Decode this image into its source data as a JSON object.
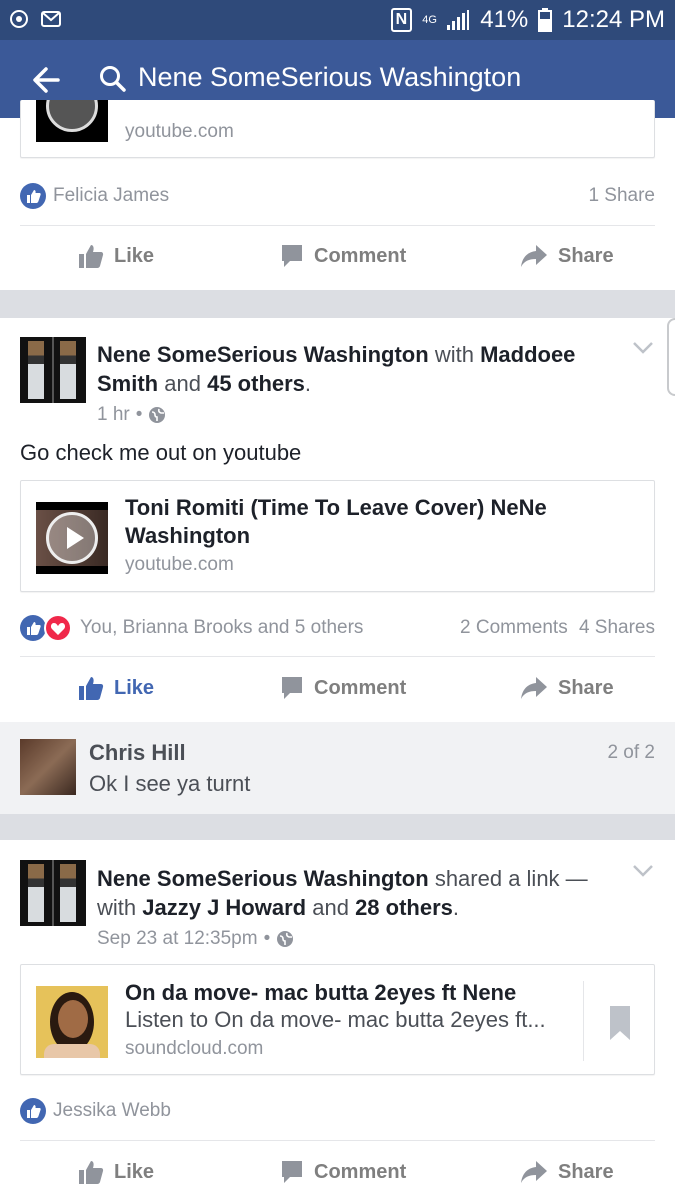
{
  "status_bar": {
    "nfc": "N",
    "network": "4G",
    "battery_percent": "41%",
    "time": "12:24 PM"
  },
  "app_bar": {
    "search_query": "Nene SomeSerious Washington"
  },
  "post0": {
    "link_domain": "youtube.com",
    "reaction_summary": "Felicia James",
    "shares": "1 Share",
    "actions": {
      "like": "Like",
      "comment": "Comment",
      "share": "Share"
    }
  },
  "post1": {
    "author": "Nene SomeSerious Washington",
    "with_word": "with",
    "tagged_1": "Maddoee Smith",
    "and_word": "and",
    "others": "45 others",
    "period": ".",
    "time": "1 hr",
    "body": "Go check me out on youtube",
    "link_title": "Toni Romiti (Time To Leave Cover) NeNe Washington",
    "link_domain": "youtube.com",
    "reaction_summary": "You, Brianna Brooks and 5 others",
    "comments": "2 Comments",
    "shares": "4 Shares",
    "actions": {
      "like": "Like",
      "comment": "Comment",
      "share": "Share"
    },
    "comment": {
      "author": "Chris Hill",
      "text": "Ok I see ya turnt",
      "counter": "2 of 2"
    }
  },
  "post2": {
    "author": "Nene SomeSerious Washington",
    "shared_text": "shared a link —",
    "with_word": "with",
    "tagged_1": "Jazzy J Howard",
    "and_word": "and",
    "others": "28 others",
    "period": ".",
    "time": "Sep 23 at 12:35pm",
    "link_title": "On da move- mac butta 2eyes ft Nene",
    "link_desc": "Listen to On da move- mac butta 2eyes ft...",
    "link_domain": "soundcloud.com",
    "reaction_summary": "Jessika Webb",
    "actions": {
      "like": "Like",
      "comment": "Comment",
      "share": "Share"
    }
  },
  "colors": {
    "status_bar": "#2f4a7a",
    "app_bar": "#3b5998",
    "like_blue": "#4267b2",
    "love_red": "#f0284a"
  }
}
